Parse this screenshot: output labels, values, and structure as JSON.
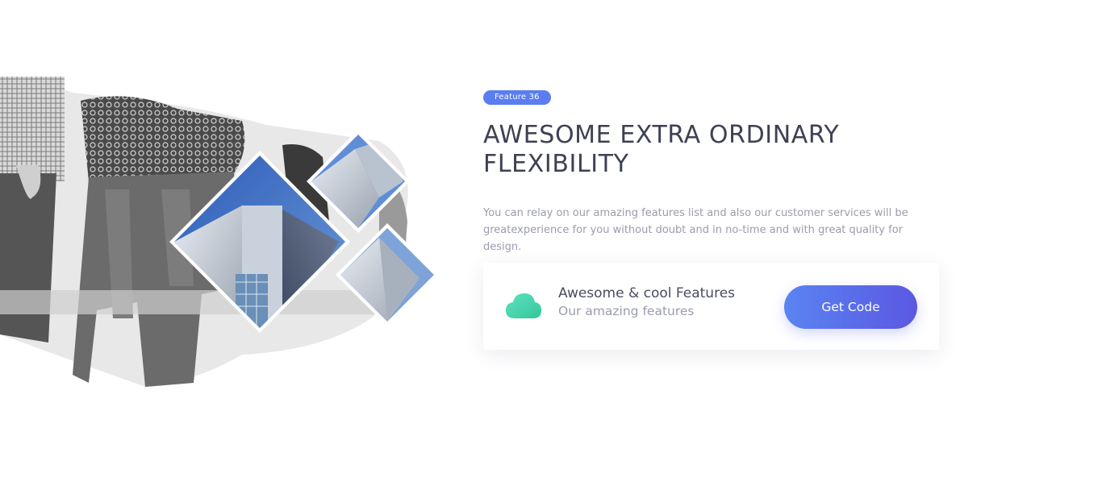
{
  "badge": {
    "label": "Feature 36"
  },
  "hero": {
    "title": "AWESOME EXTRA ORDINARY FLEXIBILITY",
    "description": "You can relay on our amazing features list and also our customer services will be greatexperience for you without doubt and in no-time and with great quality for design."
  },
  "feature_card": {
    "icon": "cloud-icon",
    "title": "Awesome & cool Features",
    "subtitle": "Our amazing features",
    "button_label": "Get Code"
  },
  "colors": {
    "badge": "#5a7df0",
    "title": "#3e4154",
    "muted_text": "#9a9cae",
    "button_start": "#5a84f2",
    "button_end": "#5b58e2",
    "cloud_start": "#35c79b",
    "cloud_end": "#5fe1bf"
  }
}
